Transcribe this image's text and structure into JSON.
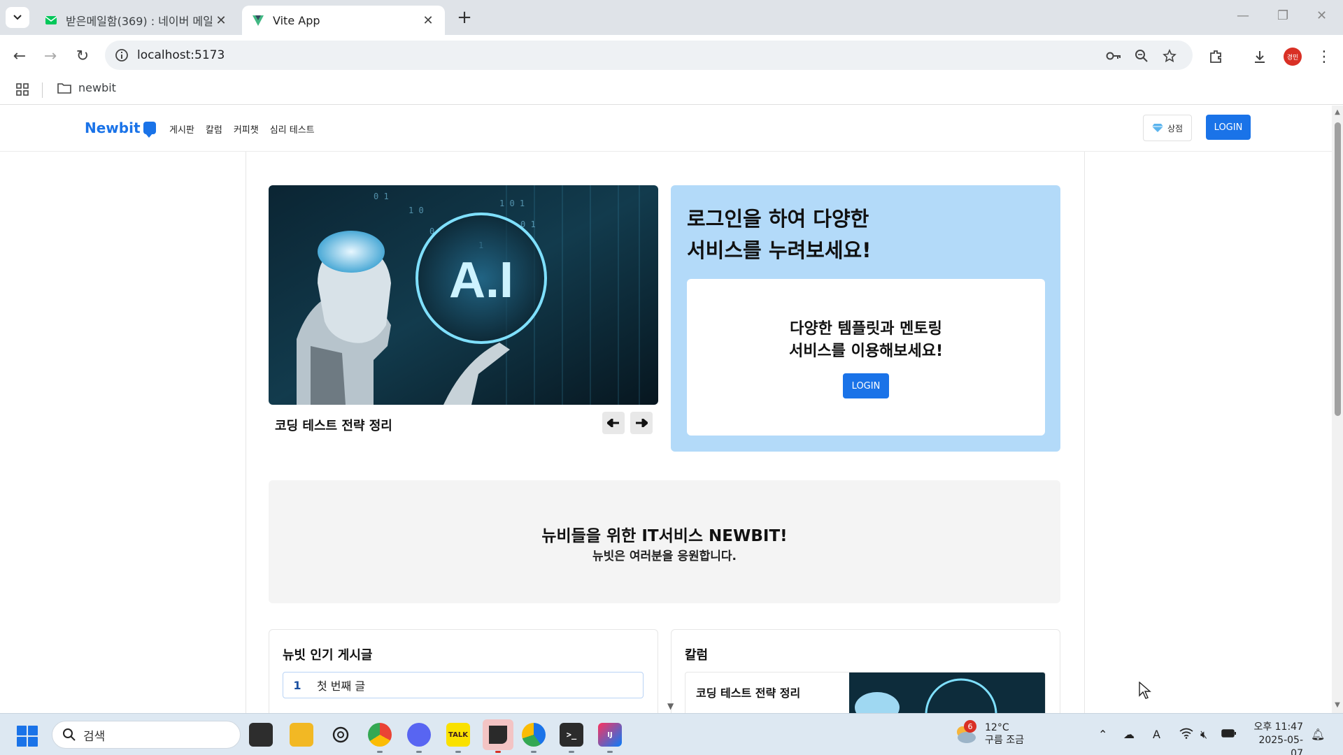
{
  "browser": {
    "tabs": [
      {
        "title": "받은메일함(369) : 네이버 메일",
        "active": false,
        "favicon": "naver-mail-icon"
      },
      {
        "title": "Vite App",
        "active": true,
        "favicon": "vite-icon"
      }
    ],
    "url": "localhost:5173",
    "profile_label": "경민",
    "bookmarks": [
      {
        "label": "newbit",
        "icon": "folder-icon"
      }
    ]
  },
  "site": {
    "logo": "Newbit",
    "nav": [
      "게시판",
      "칼럼",
      "커피챗",
      "심리 테스트"
    ],
    "shop_label": "상점",
    "login_label": "LOGIN"
  },
  "hero": {
    "image_text": "A.I",
    "caption": "코딩 테스트 전략 정리",
    "prev_arrow": "🠔",
    "next_arrow": "🠖"
  },
  "login_panel": {
    "title": "로그인을 하여 다양한\n서비스를 누려보세요!",
    "inner_text": "다양한 템플릿과 멘토링\n서비스를 이용해보세요!",
    "button": "LOGIN"
  },
  "banner": {
    "title": "뉴비들을 위한 IT서비스 NEWBIT!",
    "subtitle": "뉴빗은 여러분을 응원합니다."
  },
  "popular": {
    "title": "뉴빗 인기 게시글",
    "items": [
      {
        "rank": "1",
        "title": "첫 번째 글"
      }
    ]
  },
  "column": {
    "title": "칼럼",
    "items": [
      {
        "title": "코딩 테스트 전략 정리"
      }
    ]
  },
  "taskbar": {
    "search_placeholder": "검색",
    "weather_temp": "12°C",
    "weather_desc": "구름 조금",
    "weather_badge": "6",
    "time": "오후 11:47",
    "date": "2025-05-07",
    "ime": "A"
  },
  "colors": {
    "accent": "#1a73e8",
    "panel": "#b3daf9"
  }
}
